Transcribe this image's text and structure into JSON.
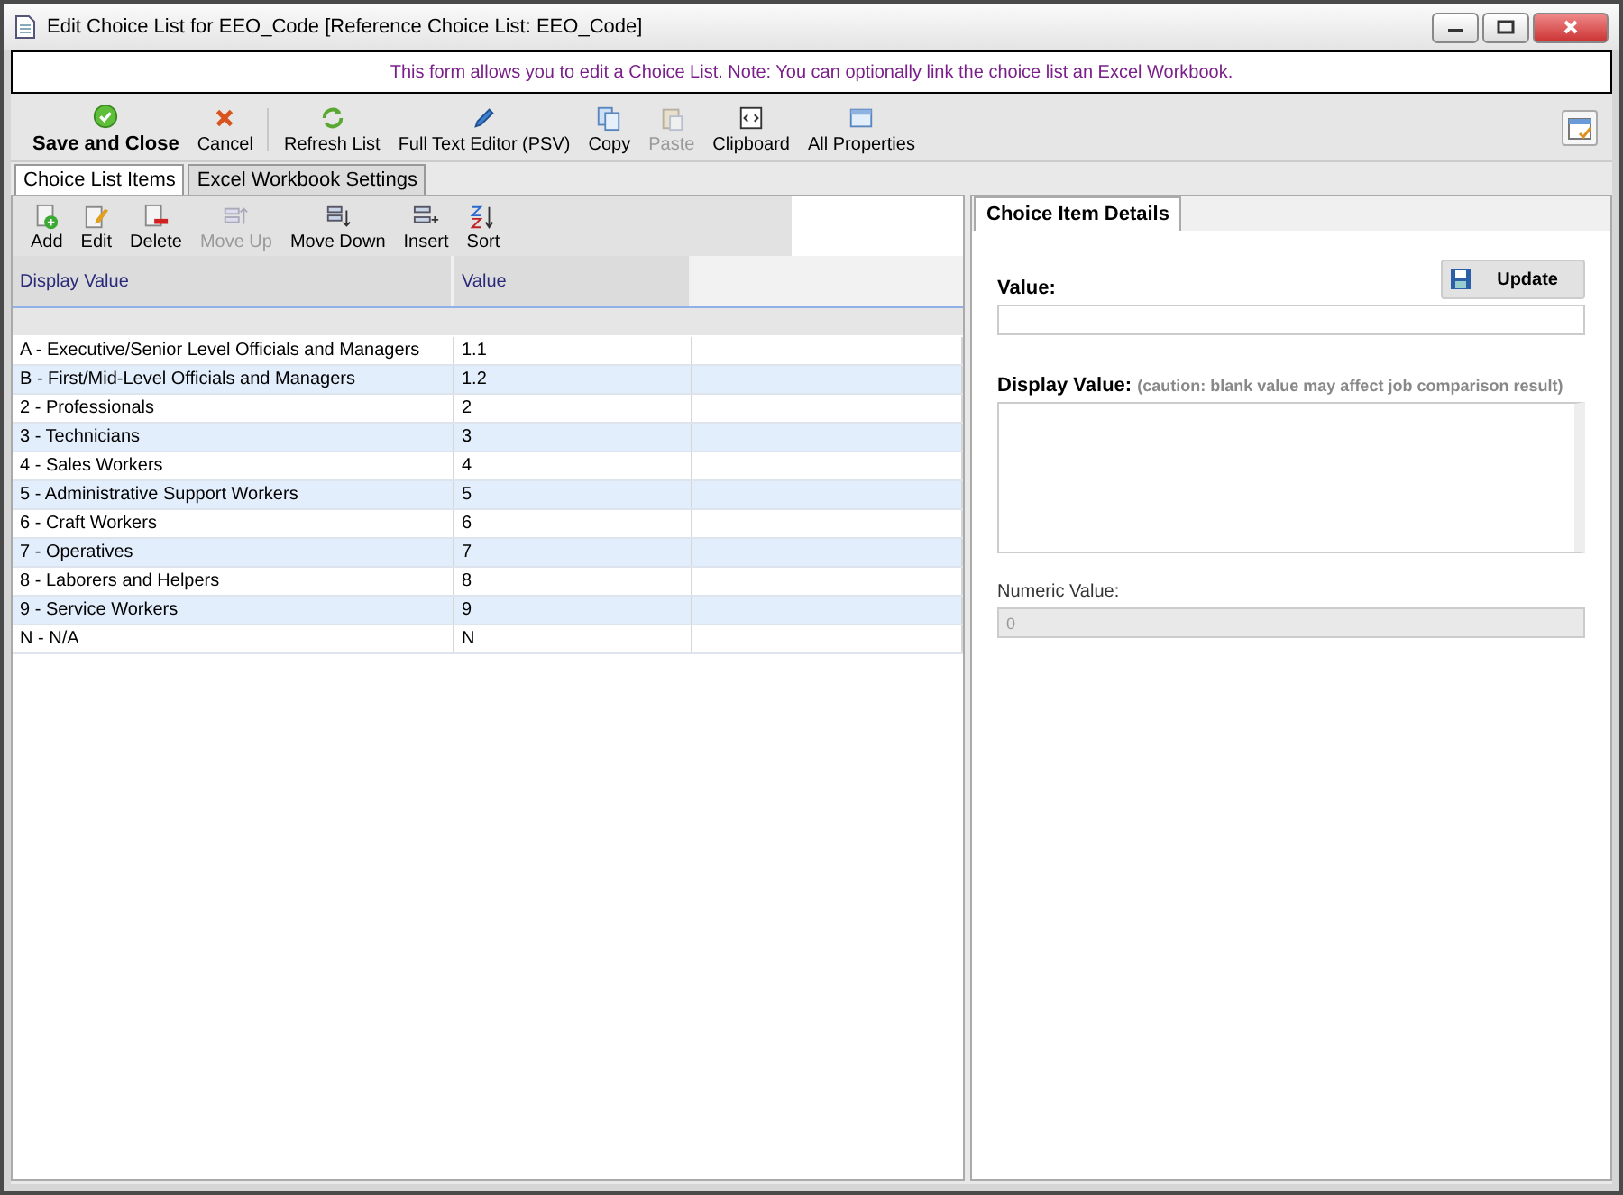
{
  "window": {
    "title": "Edit Choice List for EEO_Code [Reference Choice List: EEO_Code]"
  },
  "banner": "This form allows you to edit a Choice List.  Note: You can optionally link the choice list an Excel Workbook.",
  "toolbar": [
    {
      "label": "Save and Close",
      "kind": "primary",
      "disabled": false
    },
    {
      "label": "Cancel",
      "kind": "normal",
      "disabled": false
    },
    {
      "label": "Refresh List",
      "kind": "normal",
      "disabled": false
    },
    {
      "label": "Full Text Editor (PSV)",
      "kind": "normal",
      "disabled": false
    },
    {
      "label": "Copy",
      "kind": "normal",
      "disabled": false
    },
    {
      "label": "Paste",
      "kind": "normal",
      "disabled": true
    },
    {
      "label": "Clipboard",
      "kind": "normal",
      "disabled": false
    },
    {
      "label": "All Properties",
      "kind": "normal",
      "disabled": false
    }
  ],
  "tabs": [
    {
      "label": "Choice List Items",
      "selected": true
    },
    {
      "label": "Excel Workbook Settings",
      "selected": false
    }
  ],
  "list_toolbar": [
    {
      "label": "Add",
      "disabled": false
    },
    {
      "label": "Edit",
      "disabled": false
    },
    {
      "label": "Delete",
      "disabled": false
    },
    {
      "label": "Move Up",
      "disabled": true
    },
    {
      "label": "Move Down",
      "disabled": false
    },
    {
      "label": "Insert",
      "disabled": false
    },
    {
      "label": "Sort",
      "disabled": false
    }
  ],
  "table": {
    "columns": [
      "Display Value",
      "Value"
    ],
    "rows": [
      {
        "display": "A - Executive/Senior Level Officials and Managers",
        "value": "1.1"
      },
      {
        "display": "B - First/Mid-Level Officials and Managers",
        "value": "1.2"
      },
      {
        "display": "2 - Professionals",
        "value": "2"
      },
      {
        "display": "3 - Technicians",
        "value": "3"
      },
      {
        "display": "4 - Sales Workers",
        "value": "4"
      },
      {
        "display": "5 - Administrative Support Workers",
        "value": "5"
      },
      {
        "display": "6 - Craft Workers",
        "value": "6"
      },
      {
        "display": "7 - Operatives",
        "value": "7"
      },
      {
        "display": "8 - Laborers and Helpers",
        "value": "8"
      },
      {
        "display": "9 - Service Workers",
        "value": "9"
      },
      {
        "display": "N - N/A",
        "value": "N"
      }
    ]
  },
  "details": {
    "tab": {
      "label": "Choice Item Details",
      "selected": true
    },
    "update_button": "Update",
    "value_field": {
      "label": "Value:"
    },
    "display_field": {
      "label": "Display Value:",
      "note": "(caution: blank value may affect job comparison result)"
    },
    "numeric_field": {
      "label": "Numeric Value:",
      "value": "0",
      "disabled": true
    }
  }
}
